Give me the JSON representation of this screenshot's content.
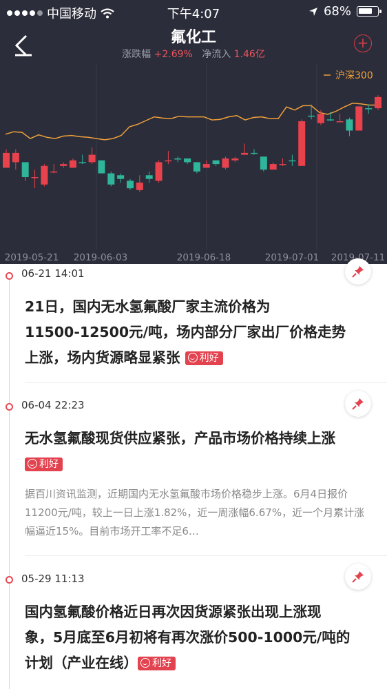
{
  "status_bar": {
    "carrier": "中国移动",
    "time": "下午4:07",
    "battery": "68%"
  },
  "header": {
    "title": "氟化工",
    "change_label": "涨跌幅",
    "change_value": "+2.69%",
    "netflow_label": "净流入",
    "netflow_value": "1.46亿"
  },
  "chart_data": {
    "type": "candlestick",
    "legend": "沪深300",
    "x_ticks": [
      "2019-05-21",
      "2019-06-03",
      "2019-06-18",
      "2019-07-01",
      "2019-07-11"
    ],
    "index_line": [
      108,
      112,
      111,
      101,
      107,
      103,
      101,
      105,
      106,
      104,
      103,
      101,
      99,
      101,
      106,
      120,
      124,
      130,
      136,
      134,
      133,
      137,
      136,
      136,
      136,
      131,
      132,
      136,
      138,
      131,
      135,
      136,
      133,
      133,
      152,
      147,
      154,
      154,
      143,
      140,
      145,
      152,
      158,
      157,
      155,
      155
    ],
    "candles": [
      {
        "o": 55,
        "c": 63,
        "h": 65,
        "l": 55
      },
      {
        "o": 58,
        "c": 63,
        "h": 65,
        "l": 54
      },
      {
        "o": 58,
        "c": 50,
        "h": 58,
        "l": 48
      },
      {
        "o": 50,
        "c": 50,
        "h": 54,
        "l": 44
      },
      {
        "o": 46,
        "c": 56,
        "h": 57,
        "l": 45
      },
      {
        "o": 53,
        "c": 53,
        "h": 57,
        "l": 52
      },
      {
        "o": 56,
        "c": 57,
        "h": 58,
        "l": 55
      },
      {
        "o": 55,
        "c": 59,
        "h": 60,
        "l": 55
      },
      {
        "o": 58,
        "c": 58,
        "h": 62,
        "l": 57
      },
      {
        "o": 58,
        "c": 62,
        "h": 66,
        "l": 57
      },
      {
        "o": 59,
        "c": 52,
        "h": 59,
        "l": 52
      },
      {
        "o": 52,
        "c": 46,
        "h": 53,
        "l": 45
      },
      {
        "o": 51,
        "c": 49,
        "h": 52,
        "l": 47
      },
      {
        "o": 48,
        "c": 44,
        "h": 49,
        "l": 43
      },
      {
        "o": 43,
        "c": 47,
        "h": 51,
        "l": 42
      },
      {
        "o": 51,
        "c": 49,
        "h": 53,
        "l": 47
      },
      {
        "o": 48,
        "c": 58,
        "h": 59,
        "l": 47
      },
      {
        "o": 59,
        "c": 59,
        "h": 64,
        "l": 57
      },
      {
        "o": 60,
        "c": 60,
        "h": 61,
        "l": 58
      },
      {
        "o": 60,
        "c": 58,
        "h": 60,
        "l": 57
      },
      {
        "o": 58,
        "c": 53,
        "h": 58,
        "l": 52
      },
      {
        "o": 55,
        "c": 57,
        "h": 59,
        "l": 55
      },
      {
        "o": 59,
        "c": 57,
        "h": 59,
        "l": 56
      },
      {
        "o": 55,
        "c": 60,
        "h": 61,
        "l": 54
      },
      {
        "o": 59,
        "c": 60,
        "h": 61,
        "l": 58
      },
      {
        "o": 62,
        "c": 63,
        "h": 68,
        "l": 62
      },
      {
        "o": 63,
        "c": 63,
        "h": 65,
        "l": 62
      },
      {
        "o": 61,
        "c": 54,
        "h": 61,
        "l": 53
      },
      {
        "o": 54,
        "c": 57,
        "h": 58,
        "l": 54
      },
      {
        "o": 57,
        "c": 57,
        "h": 60,
        "l": 56
      },
      {
        "o": 59,
        "c": 59,
        "h": 62,
        "l": 56
      },
      {
        "o": 56,
        "c": 80,
        "h": 81,
        "l": 56
      },
      {
        "o": 83,
        "c": 83,
        "h": 89,
        "l": 81
      },
      {
        "o": 79,
        "c": 84,
        "h": 86,
        "l": 78
      },
      {
        "o": 81,
        "c": 81,
        "h": 85,
        "l": 80
      },
      {
        "o": 80,
        "c": 80,
        "h": 84,
        "l": 80
      },
      {
        "o": 81,
        "c": 75,
        "h": 82,
        "l": 72
      },
      {
        "o": 75,
        "c": 88,
        "h": 88,
        "l": 75
      },
      {
        "o": 87,
        "c": 87,
        "h": 89,
        "l": 84
      },
      {
        "o": 87,
        "c": 93,
        "h": 94,
        "l": 86
      }
    ]
  },
  "feed": [
    {
      "time": "06-21 14:01",
      "title": "21日，国内无水氢氟酸厂家主流价格为11500-12500元/吨，场内部分厂家出厂价格走势上涨，场内货源略显紧张",
      "tag": "利好",
      "desc": ""
    },
    {
      "time": "06-04 22:23",
      "title": "无水氢氟酸现货供应紧张，产品市场价格持续上涨",
      "tag": "利好",
      "desc": "据百川资讯监测，近期国内无水氢氟酸市场价格稳步上涨。6月4日报价11200元/吨，较上一日上涨1.82%，近一周涨幅6.67%，近一个月累计涨幅逼近15%。目前市场开工率不足6…"
    },
    {
      "time": "05-29 11:13",
      "title": "国内氢氟酸价格近日再次因货源紧张出现上涨现象，5月底至6月初将有再次涨价500-1000元/吨的计划（产业在线）",
      "tag": "利好",
      "desc": ""
    }
  ],
  "colors": {
    "up": "#e8424d",
    "down": "#2fb59a",
    "line": "#f0a03a",
    "dark_bg": "#2b2d3a"
  }
}
